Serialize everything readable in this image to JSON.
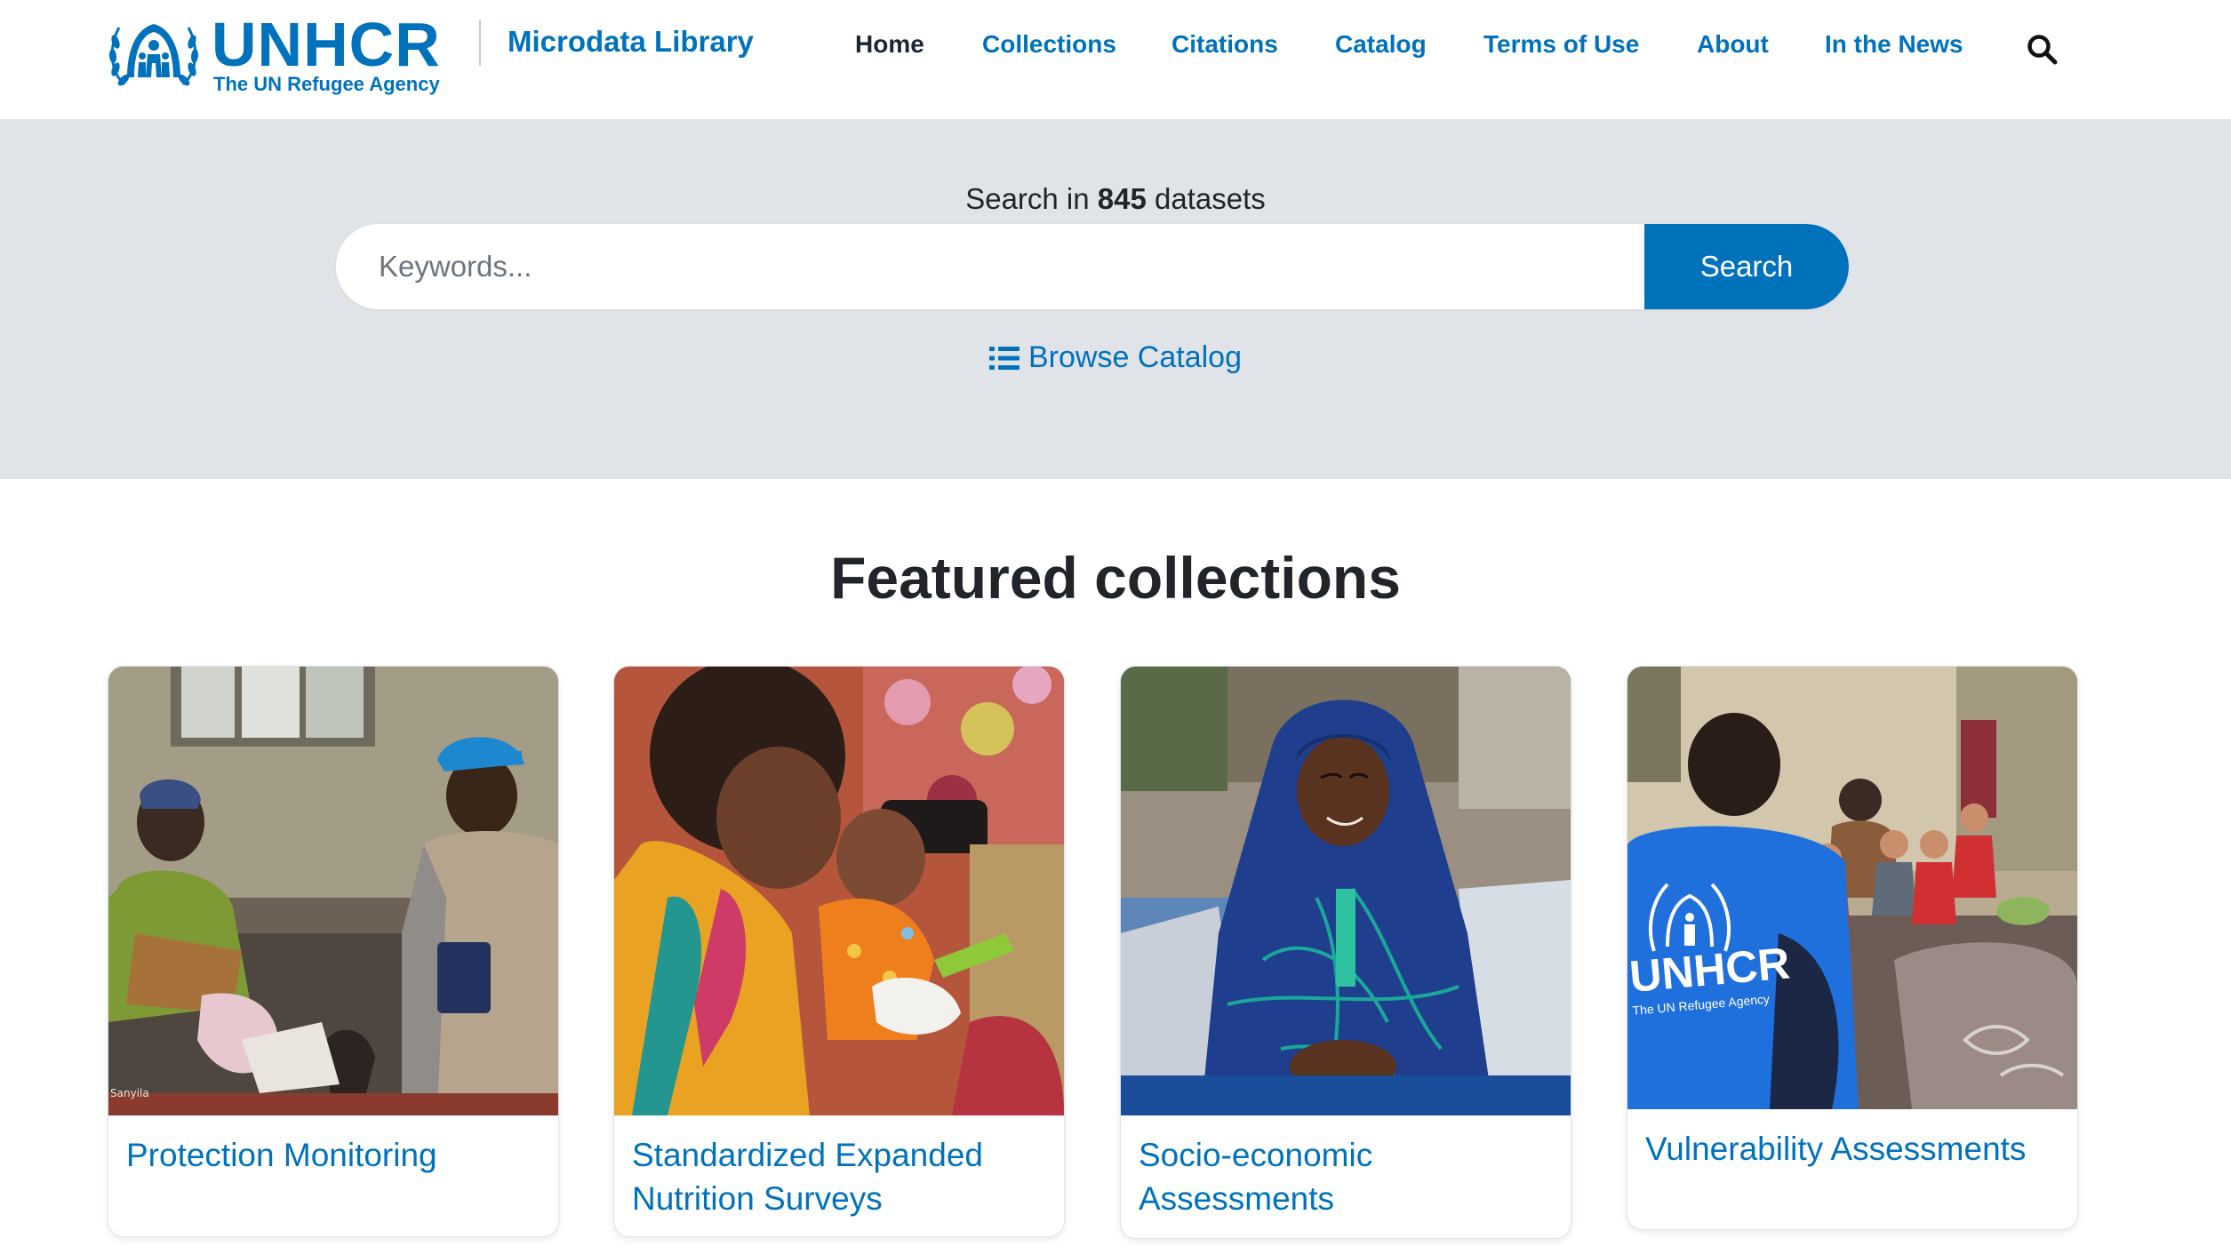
{
  "header": {
    "logo_word": "UNHCR",
    "logo_subtitle": "The UN Refugee Agency",
    "site_name": "Microdata Library",
    "nav": [
      {
        "label": "Home",
        "active": true
      },
      {
        "label": "Collections",
        "active": false
      },
      {
        "label": "Citations",
        "active": false
      },
      {
        "label": "Catalog",
        "active": false
      },
      {
        "label": "Terms of Use",
        "active": false
      },
      {
        "label": "About",
        "active": false
      },
      {
        "label": "In the News",
        "active": false
      }
    ],
    "search_icon": "search-icon"
  },
  "hero": {
    "count_prefix": "Search in",
    "count": "845",
    "count_suffix": "datasets",
    "placeholder": "Keywords...",
    "value": "",
    "button_label": "Search",
    "browse_label": "Browse Catalog",
    "browse_icon": "list-icon"
  },
  "featured": {
    "title": "Featured collections",
    "cards": [
      {
        "title": "Protection Monitoring",
        "photo_credit": "Sanyila"
      },
      {
        "title": "Standardized Expanded Nutrition Surveys"
      },
      {
        "title": "Socio-economic Assessments"
      },
      {
        "title": "Vulnerability Assessments",
        "shirt_logo_word": "UNHCR",
        "shirt_logo_sub": "The UN Refugee Agency"
      }
    ]
  },
  "colors": {
    "brand_blue": "#0072bc",
    "hero_bg": "#e0e3e7",
    "nav_active": "#1b2533"
  }
}
